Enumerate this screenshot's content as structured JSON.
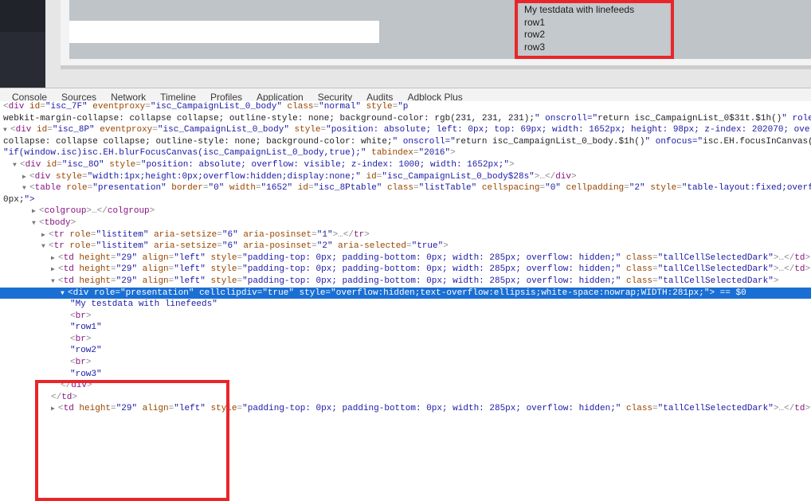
{
  "tooltip": {
    "name": "hover-tooltip",
    "lines": [
      "My testdata with linefeeds",
      "row1",
      "row2",
      "row3"
    ],
    "text": "My testdata with linefeeds\nrow1\nrow2\nrow3",
    "background_color": "#c4c9cd",
    "annotation_color": "#e8262a"
  },
  "devtools": {
    "tabs": [
      {
        "label": "Console"
      },
      {
        "label": "Sources"
      },
      {
        "label": "Network"
      },
      {
        "label": "Timeline"
      },
      {
        "label": "Profiles"
      },
      {
        "label": "Application"
      },
      {
        "label": "Security"
      },
      {
        "label": "Audits"
      },
      {
        "label": "Adblock Plus"
      }
    ],
    "selection_color": "#1a6fd4",
    "selected_marker": "== $0"
  },
  "dom_tree": {
    "lines": [
      {
        "id": "l00",
        "indent": 0,
        "clipped": true,
        "raw": "<div id=\"isc_7F\" eventproxy=\"isc_CampaignList_0_body\" class=\"normal\" style=\"p"
      },
      {
        "id": "l01",
        "indent": 0,
        "raw": "webkit-margin-collapse: collapse collapse; outline-style: none; background-color: rgb(231, 231, 231);\" onscroll=\"return isc_CampaignList_0$31t.$1h()\" role"
      },
      {
        "id": "l02",
        "indent": 0,
        "triangle": "open",
        "raw": "<div id=\"isc_8P\" eventproxy=\"isc_CampaignList_0_body\" style=\"position: absolute; left: 0px; top: 69px; width: 1652px; height: 98px; z-index: 202070; over"
      },
      {
        "id": "l03",
        "indent": 0,
        "raw": "collapse: collapse collapse; outline-style: none; background-color: white;\" onscroll=\"return isc_CampaignList_0_body.$1h()\" onfocus=\"isc.EH.focusInCanvas("
      },
      {
        "id": "l04",
        "indent": 0,
        "raw": "\"if(window.isc)isc.EH.blurFocusCanvas(isc_CampaignList_0_body,true);\" tabindex=\"2016\">"
      },
      {
        "id": "l05",
        "indent": 1,
        "triangle": "open",
        "raw": "<div id=\"isc_8O\" style=\"position: absolute; overflow: visible; z-index: 1000; width: 1652px;\">"
      },
      {
        "id": "l06",
        "indent": 2,
        "triangle": "closed",
        "raw": "<div style=\"width:1px;height:0px;overflow:hidden;display:none;\" id=\"isc_CampaignList_0_body$28s\">…</div>"
      },
      {
        "id": "l07",
        "indent": 2,
        "triangle": "open",
        "raw": "<table role=\"presentation\" border=\"0\" width=\"1652\" id=\"isc_8Ptable\" class=\"listTable\" cellspacing=\"0\" cellpadding=\"2\" style=\"table-layout:fixed;overf"
      },
      {
        "id": "l08",
        "indent": 0,
        "raw": "0px;\">"
      },
      {
        "id": "l09",
        "indent": 3,
        "triangle": "closed",
        "raw": "<colgroup>…</colgroup>"
      },
      {
        "id": "l10",
        "indent": 3,
        "triangle": "open",
        "raw": "<tbody>"
      },
      {
        "id": "l11",
        "indent": 4,
        "triangle": "closed",
        "raw": "<tr role=\"listitem\" aria-setsize=\"6\" aria-posinset=\"1\">…</tr>"
      },
      {
        "id": "l12",
        "indent": 4,
        "triangle": "open",
        "raw": "<tr role=\"listitem\" aria-setsize=\"6\" aria-posinset=\"2\" aria-selected=\"true\">"
      },
      {
        "id": "l13",
        "indent": 5,
        "triangle": "closed",
        "raw": "<td height=\"29\" align=\"left\" style=\"padding-top: 0px; padding-bottom: 0px; width: 285px; overflow: hidden;\" class=\"tallCellSelectedDark\">…</td>"
      },
      {
        "id": "l14",
        "indent": 5,
        "triangle": "closed",
        "raw": "<td height=\"29\" align=\"left\" style=\"padding-top: 0px; padding-bottom: 0px; width: 285px; overflow: hidden;\" class=\"tallCellSelectedDark\">…</td>"
      },
      {
        "id": "l15",
        "indent": 5,
        "triangle": "open",
        "raw": "<td height=\"29\" align=\"left\" style=\"padding-top: 0px; padding-bottom: 0px; width: 285px; overflow: hidden;\" class=\"tallCellSelectedDark\">"
      },
      {
        "id": "l16",
        "indent": 6,
        "triangle": "open",
        "selected": true,
        "raw": "<div role=\"presentation\" cellclipdiv=\"true\" style=\"overflow:hidden;text-overflow:ellipsis;white-space:nowrap;WIDTH:281px;\"> == $0"
      },
      {
        "id": "l17",
        "indent": 7,
        "raw": "\"My testdata with linefeeds\""
      },
      {
        "id": "l18",
        "indent": 7,
        "raw": "<br>"
      },
      {
        "id": "l19",
        "indent": 7,
        "raw": "\"row1\""
      },
      {
        "id": "l20",
        "indent": 7,
        "raw": "<br>"
      },
      {
        "id": "l21",
        "indent": 7,
        "raw": "\"row2\""
      },
      {
        "id": "l22",
        "indent": 7,
        "raw": "<br>"
      },
      {
        "id": "l23",
        "indent": 7,
        "raw": "\"row3\""
      },
      {
        "id": "l24",
        "indent": 6,
        "raw": "</div>"
      },
      {
        "id": "l25",
        "indent": 5,
        "raw": "</td>"
      },
      {
        "id": "l26",
        "indent": 5,
        "triangle": "closed",
        "raw": "<td height=\"29\" align=\"left\" style=\"padding-top: 0px; padding-bottom: 0px; width: 285px; overflow: hidden;\" class=\"tallCellSelectedDark\">…</td>"
      }
    ]
  }
}
